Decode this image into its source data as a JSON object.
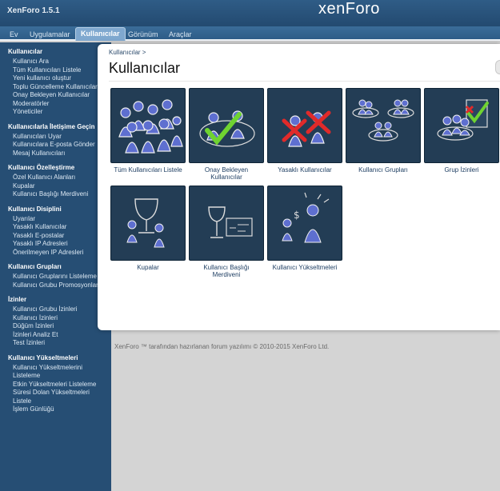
{
  "app_title": "XenForo 1.5.1",
  "logo": {
    "part1": "xen",
    "part2": "Foro"
  },
  "tabs": [
    {
      "label": "Ev"
    },
    {
      "label": "Uygulamalar"
    },
    {
      "label": "Kullanıcılar"
    },
    {
      "label": "Görünüm"
    },
    {
      "label": "Araçlar"
    }
  ],
  "sidebar": {
    "sections": [
      {
        "heading": "Kullanıcılar",
        "items": [
          "Kullanıcı Ara",
          "Tüm Kullanıcıları Listele",
          "Yeni kullanıcı oluştur",
          "Toplu Güncelleme Kullanıcıları",
          "Onay Bekleyen Kullanıcılar",
          "Moderatörler",
          "Yöneticiler"
        ]
      },
      {
        "heading": "Kullanıcılarla İletişime Geçin",
        "items": [
          "Kullanıcıları Uyar",
          "Kullanıcılara E-posta Gönder",
          "Mesaj Kullanıcıları"
        ]
      },
      {
        "heading": "Kullanıcı Özelleştirme",
        "items": [
          "Özel Kullanıcı Alanları",
          "Kupalar",
          "Kullanıcı Başlığı Merdiveni"
        ]
      },
      {
        "heading": "Kullanıcı Disiplini",
        "items": [
          "Uyarılar",
          "Yasaklı Kullanıcılar",
          "Yasaklı E-postalar",
          "Yasaklı IP Adresleri",
          "Önerilmeyen IP Adresleri"
        ]
      },
      {
        "heading": "Kullanıcı Grupları",
        "items": [
          "Kullanıcı Gruplarını Listeleme",
          "Kullanıcı Grubu Promosyonları"
        ]
      },
      {
        "heading": "İzinler",
        "items": [
          "Kullanıcı Grubu İzinleri",
          "Kullanıcı İzinleri",
          "Düğüm İzinleri",
          "İzinleri Analiz Et",
          "Test İzinleri"
        ]
      },
      {
        "heading": "Kullanıcı Yükseltmeleri",
        "items": [
          "Kullanıcı Yükseltmelerini Listeleme",
          "Etkin Yükseltmeleri Listeleme",
          "Süresi Dolan Yükseltmeleri Listele",
          "İşlem Günlüğü"
        ]
      }
    ]
  },
  "breadcrumb": "Kullanıcılar >",
  "page_title": "Kullanıcılar",
  "tiles": [
    {
      "label": "Tüm Kullanıcıları Listele",
      "icon": "users-crowd-icon"
    },
    {
      "label": "Onay Bekleyen Kullanıcılar",
      "icon": "users-approve-icon"
    },
    {
      "label": "Yasaklı Kullanıcılar",
      "icon": "users-banned-icon"
    },
    {
      "label": "Kullanıcı Grupları",
      "icon": "user-groups-icon"
    },
    {
      "label": "Grup İzinleri",
      "icon": "group-permissions-icon"
    },
    {
      "label": "Kupalar",
      "icon": "trophy-icon"
    },
    {
      "label": "Kullanıcı Başlığı Merdiveni",
      "icon": "title-ladder-icon"
    },
    {
      "label": "Kullanıcı Yükseltmeleri",
      "icon": "user-upgrades-icon"
    }
  ],
  "footer": "XenForo ™ tarafından hazırlanan forum yazılımı © 2010-2015 XenForo Ltd.",
  "colors": {
    "header": "#234a70",
    "sidebar": "#264e74",
    "tile_bg": "#233d55",
    "approve": "#6fd331",
    "ban": "#e02a2a"
  }
}
